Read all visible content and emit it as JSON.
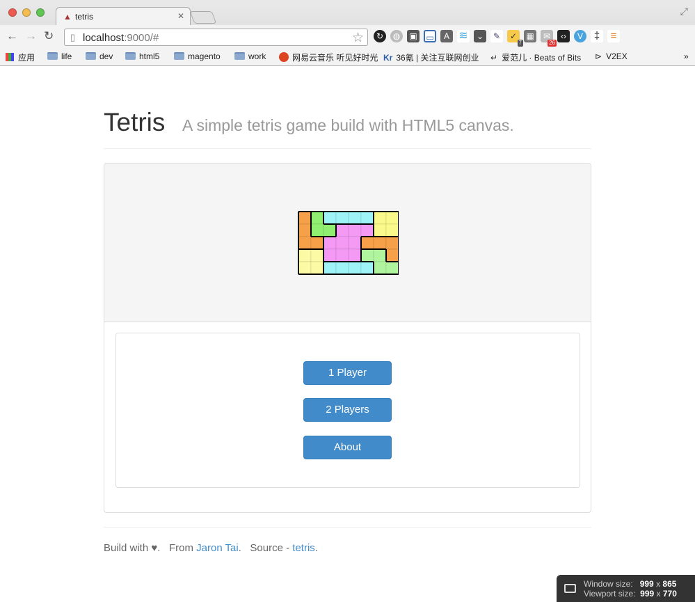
{
  "browser": {
    "tab_title": "tetris",
    "url_host": "localhost",
    "url_rest": ":9000/#",
    "bookmarks": [
      {
        "label": "应用"
      },
      {
        "label": "life"
      },
      {
        "label": "dev"
      },
      {
        "label": "html5"
      },
      {
        "label": "magento"
      },
      {
        "label": "work"
      },
      {
        "label": "网易云音乐 听见好时光"
      },
      {
        "label": "36氪 | 关注互联网创业"
      },
      {
        "label": "爱范儿 · Beats of Bits"
      },
      {
        "label": "V2EX"
      }
    ],
    "bookmarks_overflow": "»",
    "ext_badges": {
      "clip": "7",
      "mail": "26"
    },
    "colors": {
      "close": "#ee5b50",
      "minimize": "#f4bd4f",
      "maximize": "#62c655"
    }
  },
  "header": {
    "title": "Tetris",
    "subtitle": "A simple tetris game build with HTML5 canvas."
  },
  "menu": {
    "one_player": "1 Player",
    "two_players": "2 Players",
    "about": "About"
  },
  "footer": {
    "build_with": "Build with",
    "heart": "♥",
    "period1": ".",
    "from": "From",
    "author": "Jaron Tai",
    "period2": ".",
    "source": "Source -",
    "repo": "tetris",
    "period3": "."
  },
  "size_overlay": {
    "window_label": "Window size:",
    "window_w": "999",
    "window_h": "865",
    "viewport_label": "Viewport size:",
    "viewport_w": "999",
    "viewport_h": "770",
    "times": "x"
  },
  "tetris_logo": {
    "colors": {
      "A": "#f7a04a",
      "B": "#90ee70",
      "C": "#9ef3f7",
      "D": "#fafa8a",
      "E": "#f49af5",
      "F": "#fdfaa5",
      "G": "#b0f59e"
    },
    "grid": [
      "ABCCCCDD",
      "ABBEEEDD",
      "AAEEEAAA",
      "FFEEEGGA",
      "FFCCCCGG"
    ]
  }
}
